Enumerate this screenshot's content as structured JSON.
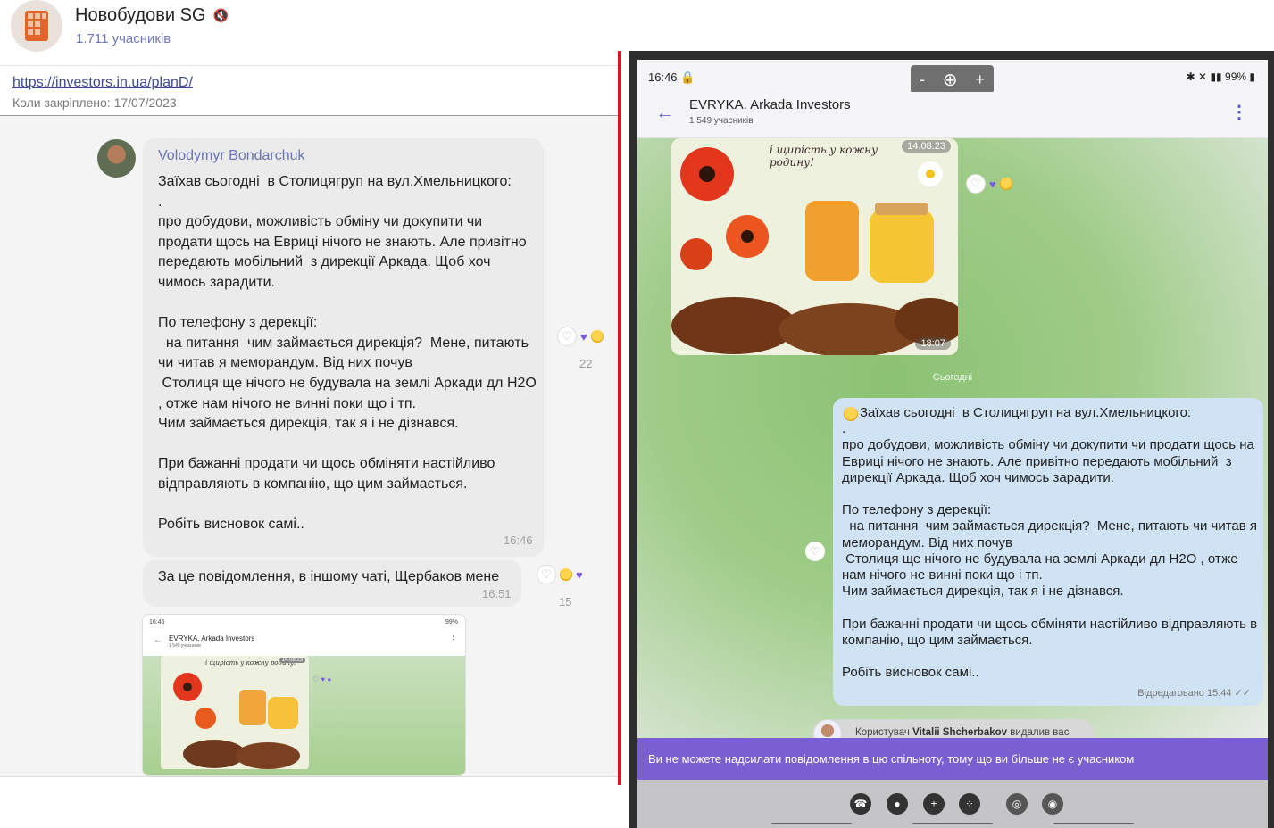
{
  "left": {
    "channel_title": "Новобудови SG",
    "mute_icon": "🔇",
    "members": "1.711 учасників",
    "pinned": {
      "link": "https://investors.in.ua/planD/",
      "date": "Коли закріплено: 17/07/2023"
    },
    "message1": {
      "author": "Volodymyr Bondarchuk",
      "text": "Заїхав сьогодні  в Столицягруп на вул.Хмельницкого:\n.\nпро добудови, можливість обміну чи докупити чи продати щось на Евриці нічого не знають. Але привітно передають мобільний  з дирекції Аркада. Щоб хоч чимось зарадити.\n\nПо телефону з дерекції:\n  на питання  чим займається дирекція?  Мене, питають чи читав я меморандум. Від них почув\n Столиця ще нічого не будувала на землі Аркади дл Н2О , отже нам нічого не винні поки що і тп.\nЧим займається дирекція, так я і не дізнався.\n\nПри бажанні продати чи щось обміняти настійливо відправляють в компанію, що цим займається.\n\nРобіть висновок самі..",
      "time": "16:46",
      "reaction_count": "22"
    },
    "message2": {
      "text": "За це повідомлення,  в іншому чаті, Щербаков мене",
      "time": "16:51",
      "reaction_count": "15"
    },
    "thumbnail": {
      "time": "16:46",
      "status": "99%",
      "title": "EVRYKA. Arkada Investors",
      "sub": "1 549 учасників",
      "caption": "і щирість у кожну родину!",
      "date": "14.08.23"
    }
  },
  "phone": {
    "time": "16:46",
    "battery": "99%",
    "zoom": {
      "minus": "-",
      "plus": "+"
    },
    "chat_title": "EVRYKA. Arkada Investors",
    "members": "1 549 учасників",
    "image_caption": "і щирість у кожну родину!",
    "image_date": "14.08.23",
    "image_time": "18:07",
    "today_label": "Сьогодні",
    "message_text": "Заїхав сьогодні  в Столицягруп на вул.Хмельницкого:\n.\nпро добудови, можливість обміну чи докупити чи продати щось на Евриці нічого не знають. Але привітно передають мобільний  з дирекції Аркада. Щоб хоч чимось зарадити.\n\nПо телефону з дерекції:\n  на питання  чим займається дирекція?  Мене, питають чи читав я меморандум. Від них почув\n Столиця ще нічого не будувала на землі Аркади дл Н2О , отже нам нічого не винні поки що і тп.\nЧим займається дирекція, так я і не дізнався.\n\nПри бажанні продати чи щось обміняти настійливо відправляють в компанію, що цим займається.\n\nРобіть висновок самі..",
    "message_footer": "Відредаговано 15:44",
    "notice_prefix": "Користувач",
    "notice_user": "Vitalii Shcherbakov",
    "notice_suffix": "видалив вас",
    "banner": "Ви не можете надсилати повідомлення в цю спільноту, тому що ви більше не є учасником"
  },
  "colors": {
    "accent": "#6b73b8",
    "divider": "#e0141c",
    "banner": "#7a5fd0",
    "bubble_blue": "#cfe3f5"
  }
}
